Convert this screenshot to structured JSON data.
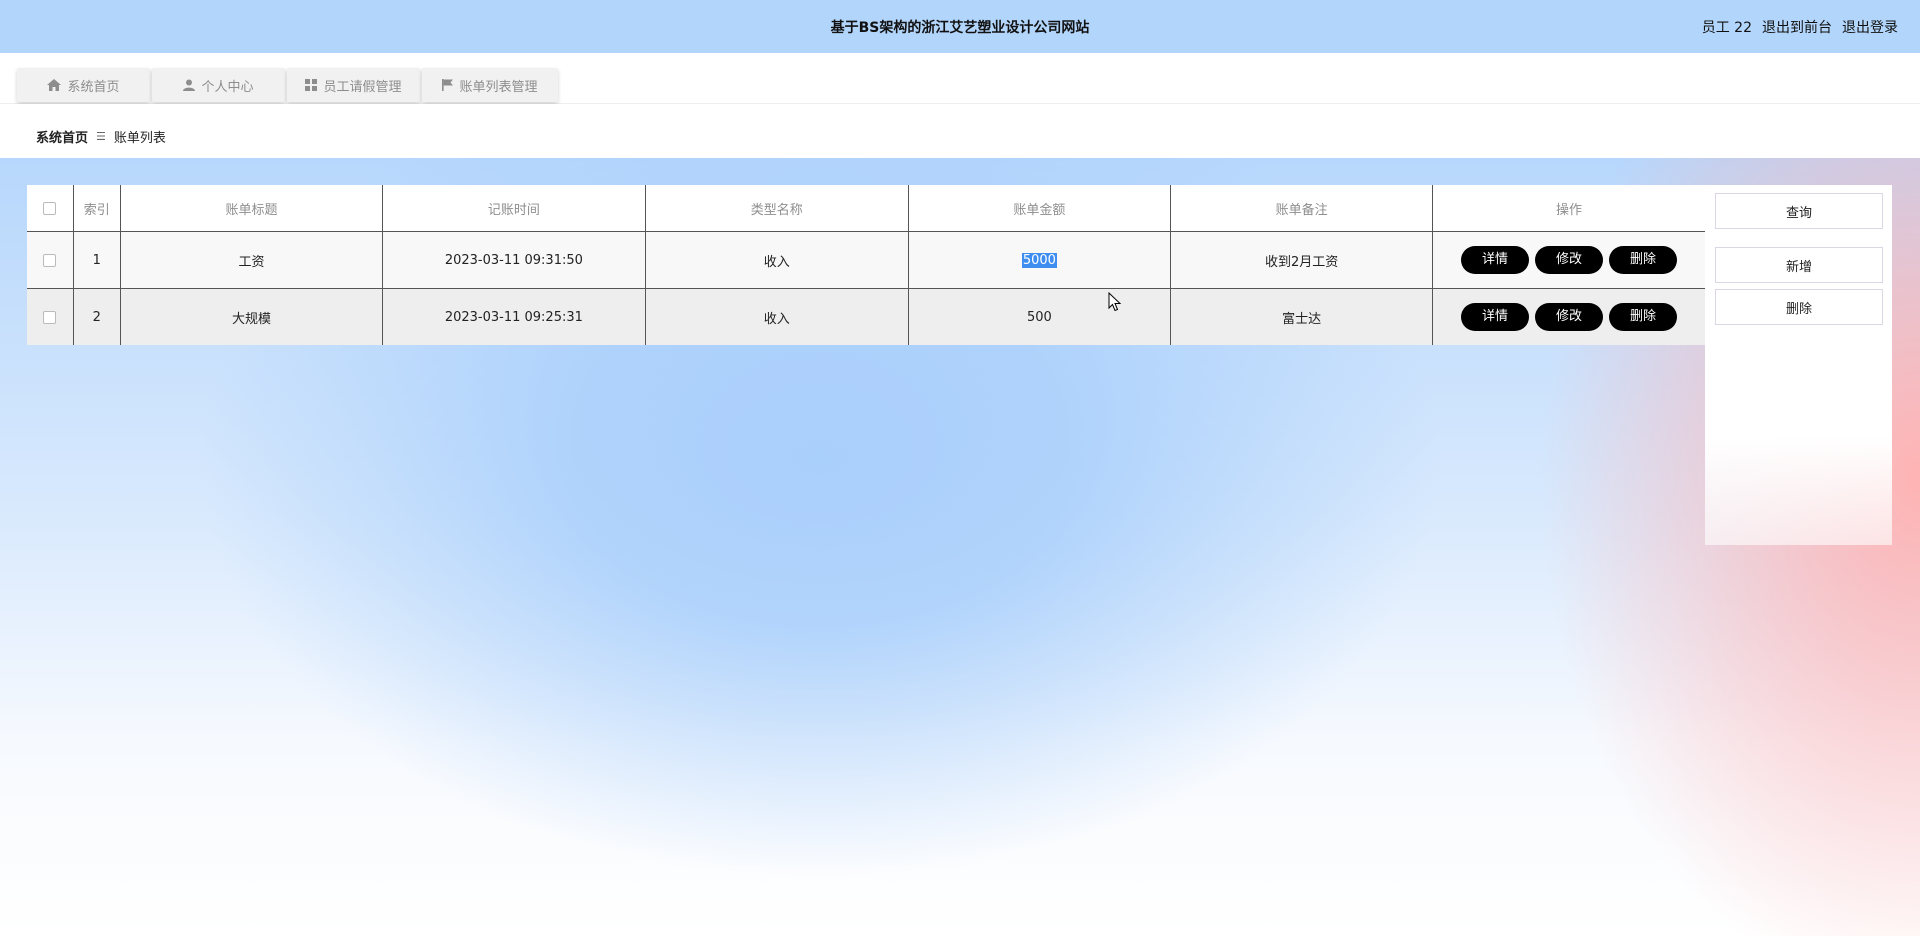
{
  "header": {
    "title": "基于BS架构的浙江艾艺塑业设计公司网站",
    "user_label": "员工 22",
    "back_to_front": "退出到前台",
    "logout": "退出登录"
  },
  "nav": {
    "tabs": [
      {
        "label": "系统首页",
        "icon": "home-icon"
      },
      {
        "label": "个人中心",
        "icon": "user-icon"
      },
      {
        "label": "员工请假管理",
        "icon": "grid-icon"
      },
      {
        "label": "账单列表管理",
        "icon": "flag-icon"
      }
    ]
  },
  "breadcrumb": {
    "home": "系统首页",
    "separator": "☰",
    "current": "账单列表"
  },
  "table": {
    "columns": [
      "索引",
      "账单标题",
      "记账时间",
      "类型名称",
      "账单金额",
      "账单备注",
      "操作"
    ],
    "rows": [
      {
        "index": "1",
        "title": "工资",
        "time": "2023-03-11 09:31:50",
        "type": "收入",
        "amount": "5000",
        "note": "收到2月工资"
      },
      {
        "index": "2",
        "title": "大规模",
        "time": "2023-03-11 09:25:31",
        "type": "收入",
        "amount": "500",
        "note": "富士达"
      }
    ],
    "actions": {
      "detail": "详情",
      "edit": "修改",
      "delete": "删除"
    }
  },
  "side": {
    "query": "查询",
    "add": "新增",
    "delete": "删除"
  },
  "colors": {
    "header_bg": "#b2d5fb",
    "button_bg": "#000000",
    "selection": "#3d8ef0"
  }
}
